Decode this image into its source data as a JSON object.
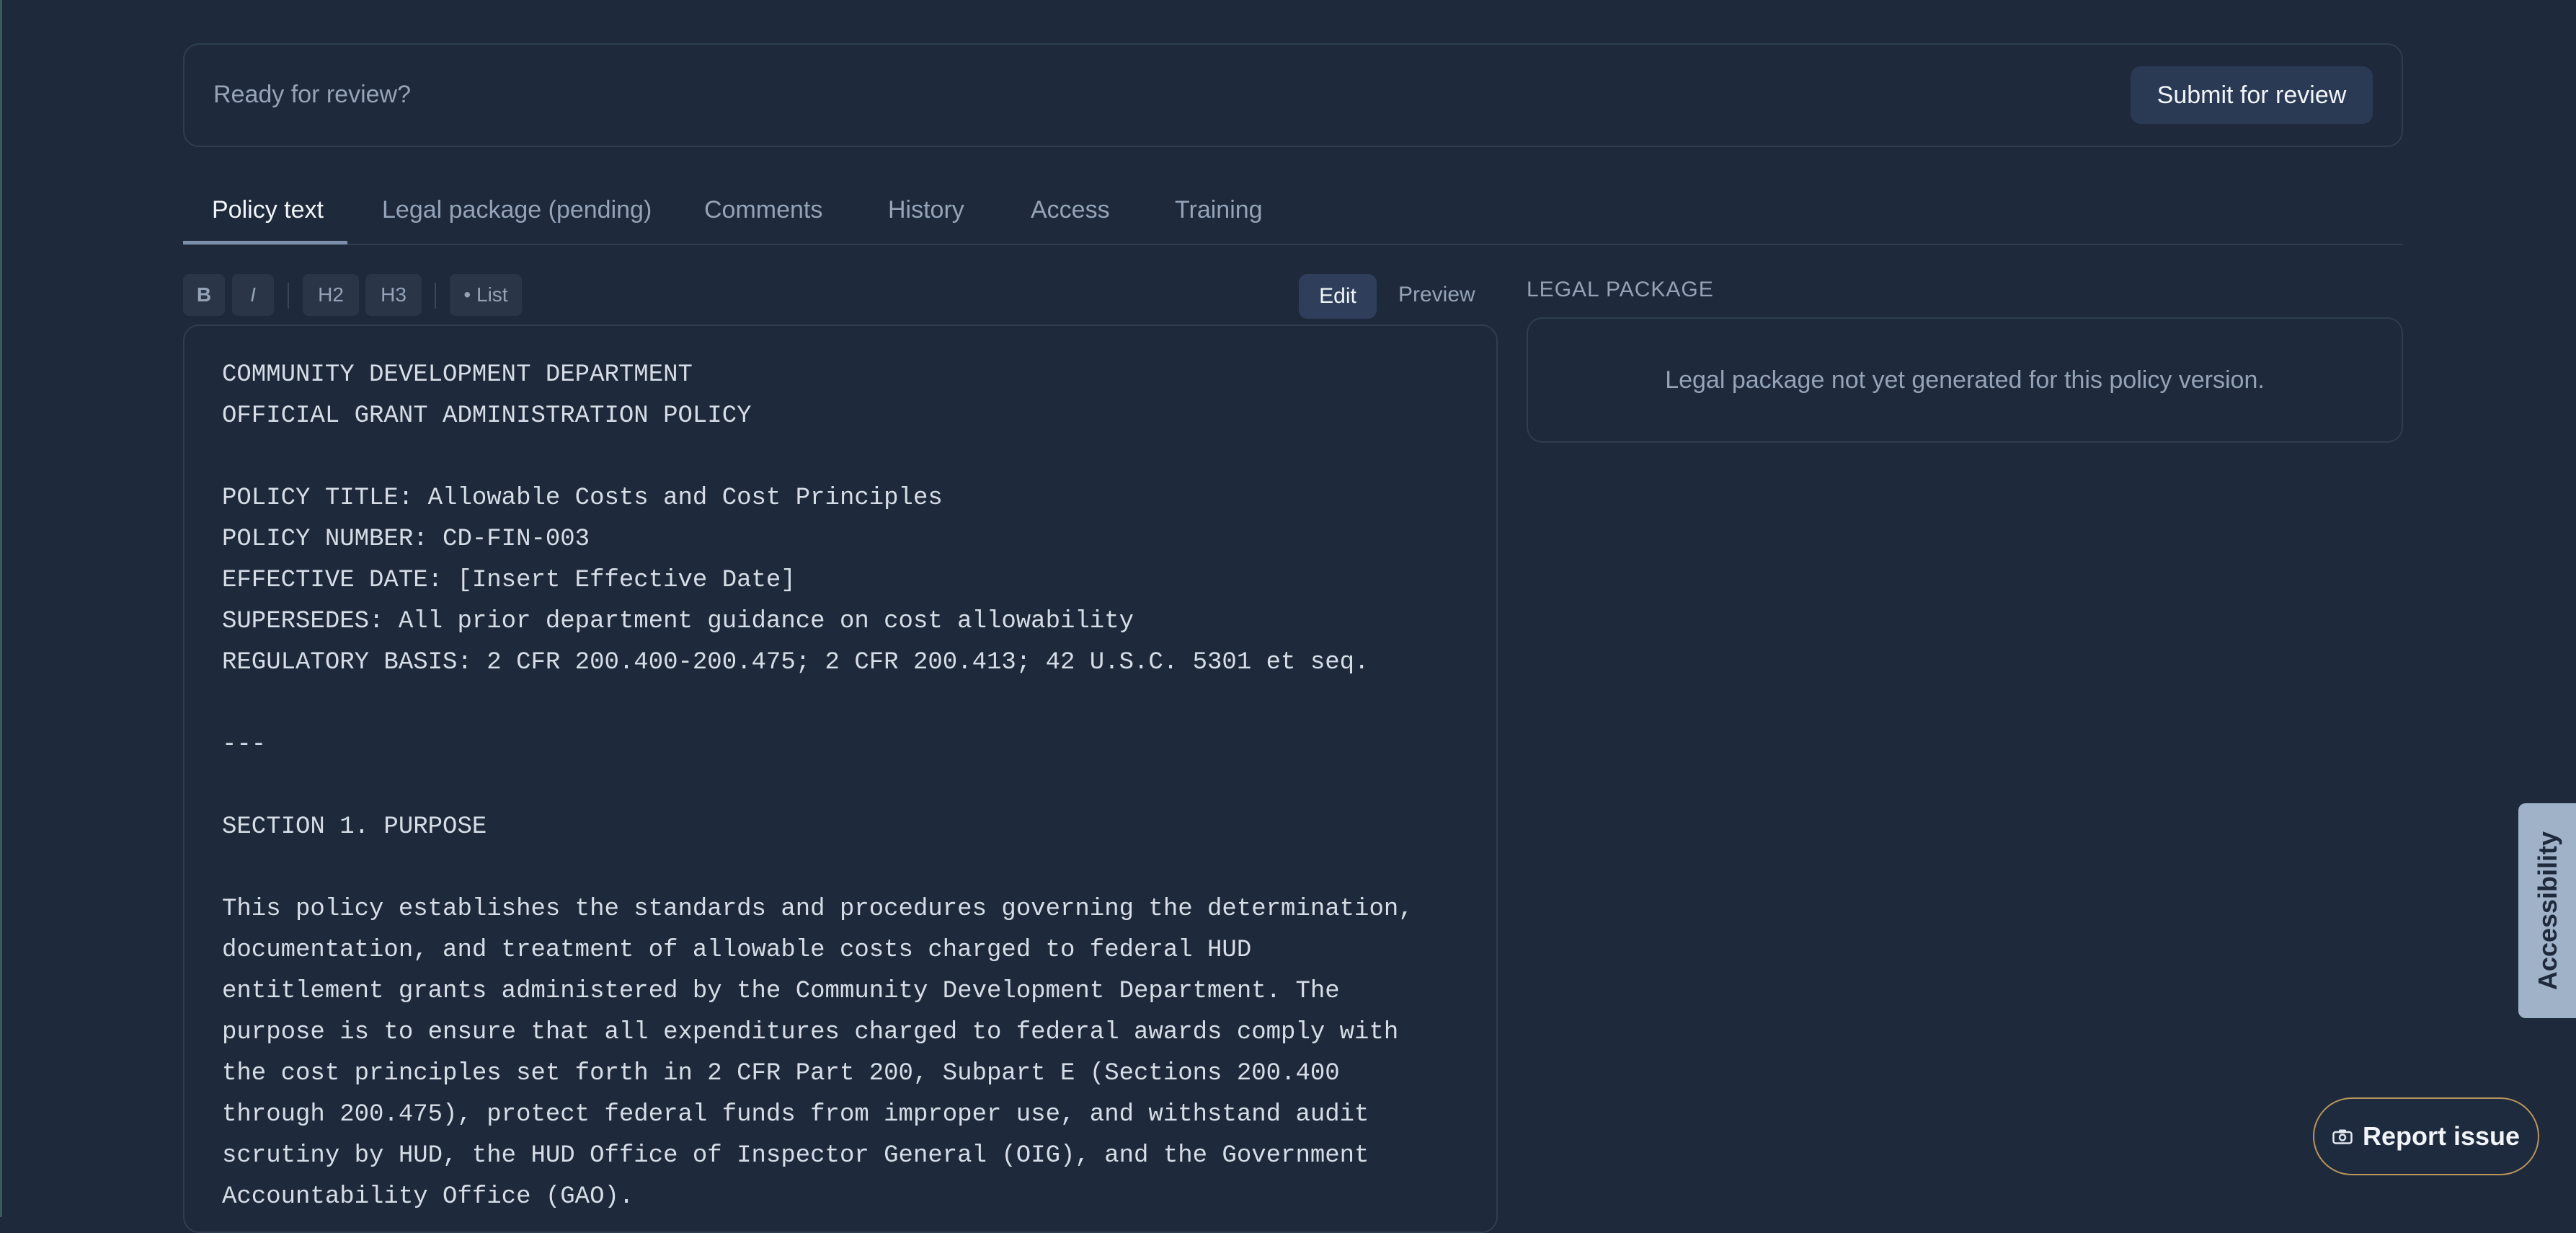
{
  "review_bar": {
    "prompt": "Ready for review?",
    "submit_label": "Submit for review"
  },
  "tabs": [
    {
      "label": "Policy text",
      "active": true
    },
    {
      "label": "Legal package (pending)",
      "active": false
    },
    {
      "label": "Comments",
      "active": false
    },
    {
      "label": "History",
      "active": false
    },
    {
      "label": "Access",
      "active": false
    },
    {
      "label": "Training",
      "active": false
    }
  ],
  "toolbar": {
    "bold": "B",
    "italic": "I",
    "h2": "H2",
    "h3": "H3",
    "list": "• List",
    "edit": "Edit",
    "preview": "Preview"
  },
  "editor": {
    "content": "COMMUNITY DEVELOPMENT DEPARTMENT\nOFFICIAL GRANT ADMINISTRATION POLICY\n\nPOLICY TITLE: Allowable Costs and Cost Principles\nPOLICY NUMBER: CD-FIN-003\nEFFECTIVE DATE: [Insert Effective Date]\nSUPERSEDES: All prior department guidance on cost allowability\nREGULATORY BASIS: 2 CFR 200.400-200.475; 2 CFR 200.413; 42 U.S.C. 5301 et seq.\n\n---\n\nSECTION 1. PURPOSE\n\nThis policy establishes the standards and procedures governing the determination,\ndocumentation, and treatment of allowable costs charged to federal HUD\nentitlement grants administered by the Community Development Department. The\npurpose is to ensure that all expenditures charged to federal awards comply with\nthe cost principles set forth in 2 CFR Part 200, Subpart E (Sections 200.400\nthrough 200.475), protect federal funds from improper use, and withstand audit\nscrutiny by HUD, the HUD Office of Inspector General (OIG), and the Government\nAccountability Office (GAO)."
  },
  "legal_package": {
    "heading": "LEGAL PACKAGE",
    "message": "Legal package not yet generated for this policy version."
  },
  "accessibility_label": "Accessibility",
  "report_issue_label": "Report issue"
}
